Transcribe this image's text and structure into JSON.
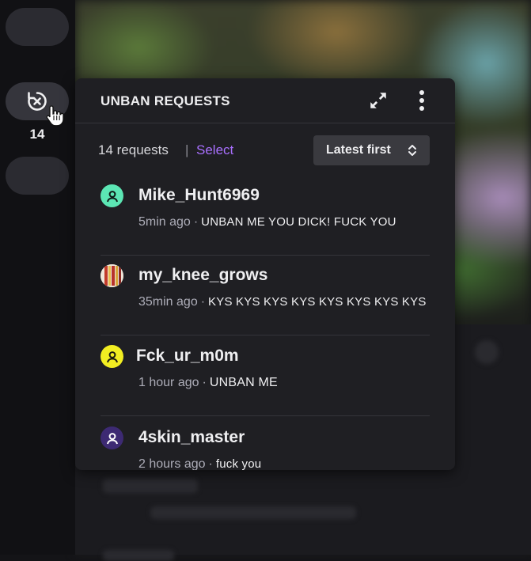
{
  "rail": {
    "count": "14"
  },
  "panel": {
    "title": "UNBAN REQUESTS",
    "request_count": "14 requests",
    "divider": "|",
    "select_label": "Select",
    "sort_label": "Latest first"
  },
  "requests": [
    {
      "username": "Mike_Hunt6969",
      "time": "5min ago",
      "message": "UNBAN ME YOU DICK! FUCK YOU",
      "avatar_color": "#5ce6b4",
      "avatar_type": "default"
    },
    {
      "username": "my_knee_grows",
      "time": "35min ago",
      "message": "KYS KYS KYS KYS KYS KYS KYS KYS",
      "avatar_color": "#e0c060",
      "avatar_type": "image"
    },
    {
      "username": "Fck_ur_m0m",
      "time": "1 hour ago",
      "message": "UNBAN ME",
      "avatar_color": "#f2ee22",
      "avatar_type": "default"
    },
    {
      "username": "4skin_master",
      "time": "2 hours ago",
      "message": "fuck you",
      "avatar_color": "#3d2a73",
      "avatar_type": "default"
    }
  ],
  "colors": {
    "accent": "#a970ff",
    "panel_bg": "#1f1f23"
  }
}
